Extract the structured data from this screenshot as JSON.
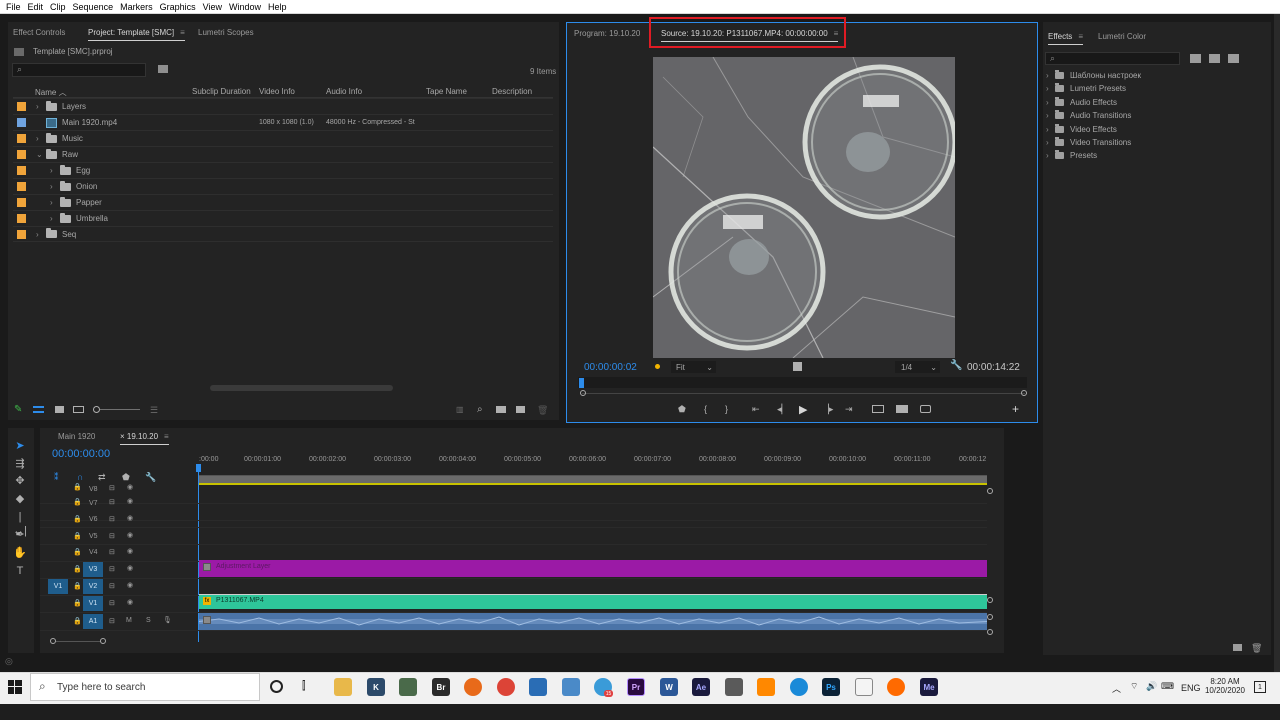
{
  "menubar": {
    "items": [
      "File",
      "Edit",
      "Clip",
      "Sequence",
      "Markers",
      "Graphics",
      "View",
      "Window",
      "Help"
    ]
  },
  "project_panel": {
    "tabs": [
      "Effect Controls",
      "Project: Template [SMC]",
      "Lumetri Scopes"
    ],
    "path": "Template [SMC].prproj",
    "item_count": "9 Items",
    "columns": [
      "Name",
      "Subclip Duration",
      "Video Info",
      "Audio Info",
      "Tape Name",
      "Description"
    ],
    "rows": [
      {
        "name": "Layers",
        "video_info": "",
        "audio_info": "",
        "color": "#f0a43a"
      },
      {
        "name": "Main 1920.mp4",
        "video_info": "1080 x 1080 (1.0)",
        "audio_info": "48000 Hz - Compressed - St",
        "color": "#6fa3e0"
      },
      {
        "name": "Music",
        "video_info": "",
        "audio_info": "",
        "color": "#f0a43a"
      },
      {
        "name": "Raw",
        "video_info": "",
        "audio_info": "",
        "color": "#f0a43a"
      },
      {
        "name": "Egg",
        "video_info": "",
        "audio_info": "",
        "color": "#f0a43a"
      },
      {
        "name": "Onion",
        "video_info": "",
        "audio_info": "",
        "color": "#f0a43a"
      },
      {
        "name": "Papper",
        "video_info": "",
        "audio_info": "",
        "color": "#f0a43a"
      },
      {
        "name": "Umbrella",
        "video_info": "",
        "audio_info": "",
        "color": "#f0a43a"
      },
      {
        "name": "Seq",
        "video_info": "",
        "audio_info": "",
        "color": "#f0a43a"
      }
    ]
  },
  "monitor": {
    "program_tab": "Program: 19.10.20",
    "source_tab": "Source: 19.10.20: P1311067.MP4: 00:00:00:00",
    "timecode_current": "00:00:00:02",
    "timecode_duration": "00:00:14:22",
    "fit": "Fit",
    "resolution": "1/4"
  },
  "effects_panel": {
    "tabs": [
      "Effects",
      "Lumetri Color"
    ],
    "items": [
      "Шаблоны настроек",
      "Lumetri Presets",
      "Audio Effects",
      "Audio Transitions",
      "Video Effects",
      "Video Transitions",
      "Presets"
    ]
  },
  "timeline": {
    "tabs": [
      "Main 1920",
      "19.10.20"
    ],
    "timecode": "00:00:00:00",
    "ruler": [
      ":00:00",
      "00:00:01:00",
      "00:00:02:00",
      "00:00:03:00",
      "00:00:04:00",
      "00:00:05:00",
      "00:00:06:00",
      "00:00:07:00",
      "00:00:08:00",
      "00:00:09:00",
      "00:00:10:00",
      "00:00:11:00",
      "00:00:12"
    ],
    "video_tracks": [
      "V8",
      "V7",
      "V6",
      "V5",
      "V4",
      "V3",
      "V2",
      "V1"
    ],
    "audio_tracks": [
      "A1"
    ],
    "source_patch": "V1",
    "clips": {
      "adjustment": "Adjustment Layer",
      "video": "P1311067.MP4"
    },
    "audio_toggles": [
      "M",
      "S"
    ]
  },
  "taskbar": {
    "search_placeholder": "Type here to search",
    "lang": "ENG",
    "time": "8:20 AM",
    "date": "10/20/2020",
    "notification_count": "1",
    "apps": [
      {
        "label": "Br",
        "color": "#2a2a2a",
        "fg": "#ffffff"
      },
      {
        "label": "Pr",
        "color": "#2a0a3f",
        "fg": "#d6a8ff"
      },
      {
        "label": "W",
        "color": "#2b5797",
        "fg": "#ffffff"
      },
      {
        "label": "Ae",
        "color": "#1a1a3d",
        "fg": "#a8a8ff"
      },
      {
        "label": "Ps",
        "color": "#0b2236",
        "fg": "#31a8ff"
      },
      {
        "label": "Me",
        "color": "#1a1a3d",
        "fg": "#a8a8ff"
      }
    ]
  },
  "colors": {
    "accent_blue": "#2d8ceb",
    "highlight_red": "#e01b24",
    "adjustment_clip": "#9b1aa6",
    "video_clip": "#2ec69a",
    "audio_clip": "#4b74a8"
  }
}
